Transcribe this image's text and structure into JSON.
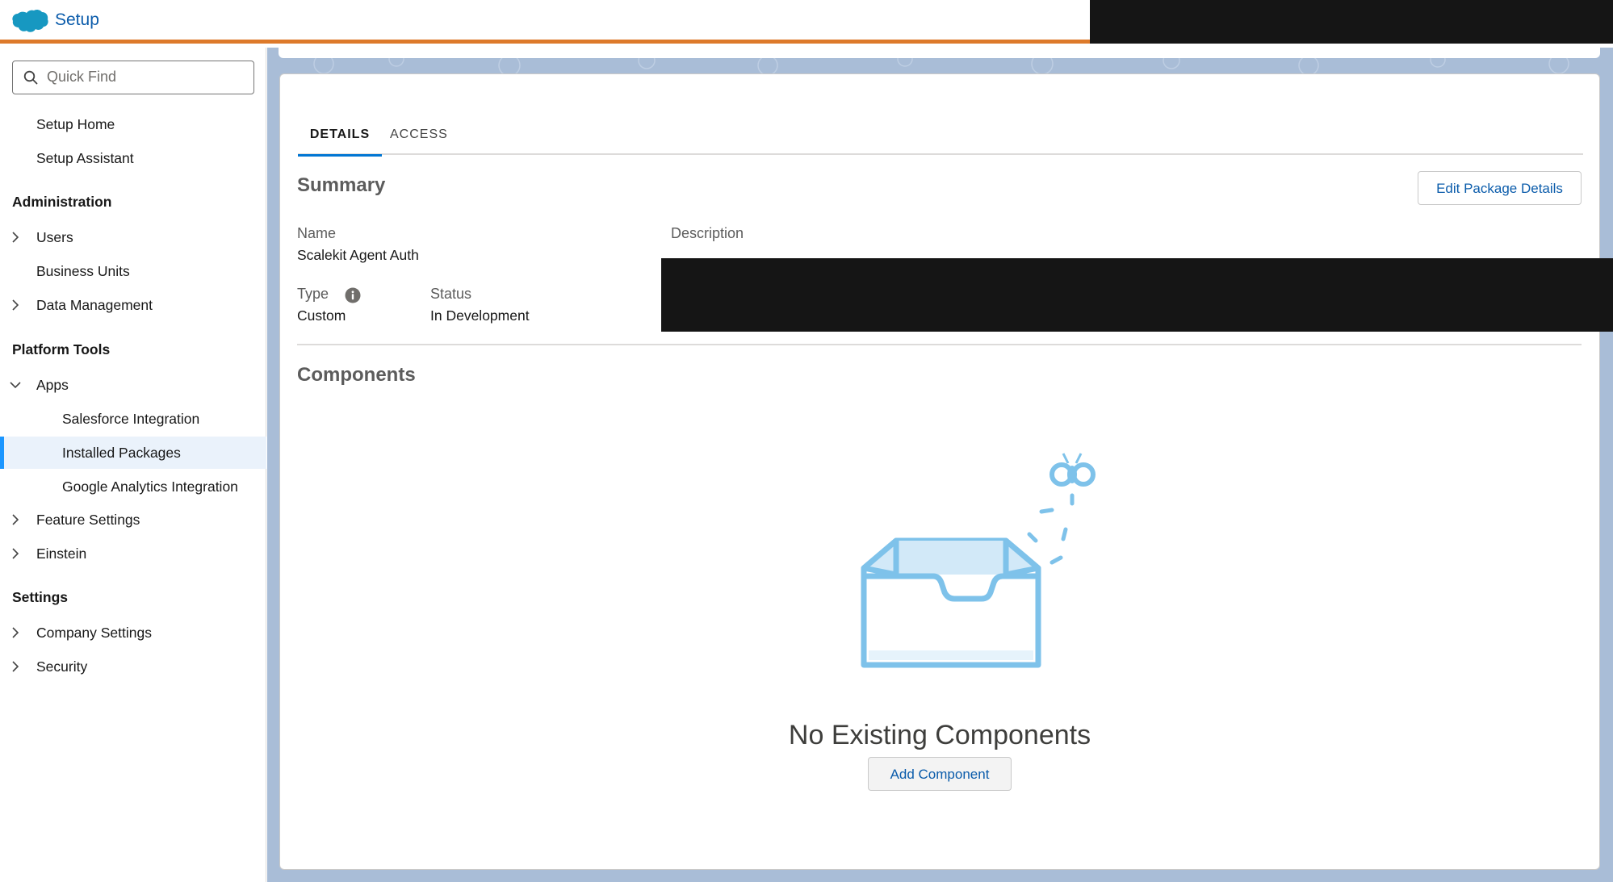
{
  "header": {
    "app_name": "Setup",
    "brand_color": "#0176d3",
    "accent_color": "#dd7a2b",
    "logo_icon": "salesforce-cloud-icon"
  },
  "sidebar": {
    "quick_find": {
      "placeholder": "Quick Find",
      "value": "",
      "icon": "search-icon"
    },
    "top_items": [
      {
        "label": "Setup Home"
      },
      {
        "label": "Setup Assistant"
      }
    ],
    "sections": [
      {
        "title": "Administration",
        "items": [
          {
            "label": "Users",
            "expandable": true,
            "expanded": false
          },
          {
            "label": "Business Units",
            "expandable": false
          },
          {
            "label": "Data Management",
            "expandable": true,
            "expanded": false
          }
        ]
      },
      {
        "title": "Platform Tools",
        "items": [
          {
            "label": "Apps",
            "expandable": true,
            "expanded": true,
            "children": [
              {
                "label": "Salesforce Integration"
              },
              {
                "label": "Installed Packages",
                "selected": true
              },
              {
                "label": "Google Analytics Integration"
              }
            ]
          },
          {
            "label": "Feature Settings",
            "expandable": true,
            "expanded": false
          },
          {
            "label": "Einstein",
            "expandable": true,
            "expanded": false
          }
        ]
      },
      {
        "title": "Settings",
        "items": [
          {
            "label": "Company Settings",
            "expandable": true,
            "expanded": false
          },
          {
            "label": "Security",
            "expandable": true,
            "expanded": false
          }
        ]
      }
    ]
  },
  "main": {
    "tabs": [
      {
        "label": "DETAILS",
        "active": true
      },
      {
        "label": "ACCESS",
        "active": false
      }
    ],
    "summary": {
      "title": "Summary",
      "edit_button": "Edit Package Details",
      "name_label": "Name",
      "name_value": "Scalekit Agent Auth",
      "description_label": "Description",
      "type_label": "Type",
      "type_value": "Custom",
      "status_label": "Status",
      "status_value": "In Development"
    },
    "components": {
      "title": "Components",
      "empty_title": "No Existing Components",
      "add_button": "Add Component"
    }
  }
}
